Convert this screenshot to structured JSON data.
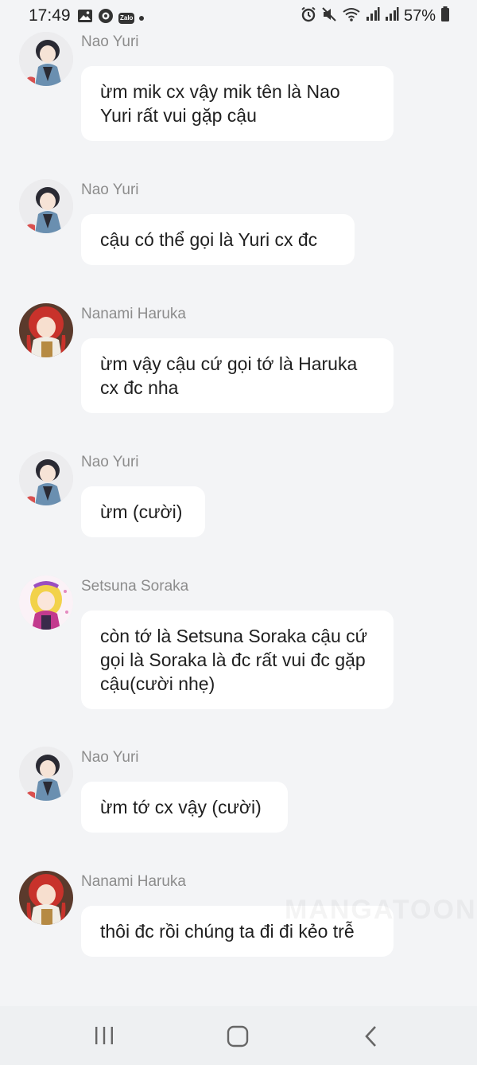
{
  "status_bar": {
    "time": "17:49",
    "battery": "57%",
    "zalo_badge": "Zalo",
    "icons": [
      "image-icon",
      "messenger-icon",
      "zalo-icon",
      "dot-icon",
      "alarm-icon",
      "mute-icon",
      "wifi-icon",
      "signal-icon",
      "signal-icon",
      "battery-icon"
    ]
  },
  "messages": [
    {
      "sender": "Nao Yuri",
      "avatar": "nao-yuri",
      "text": "ừm mik cx vậy mik tên là Nao Yuri rất vui gặp cậu"
    },
    {
      "sender": "Nao Yuri",
      "avatar": "nao-yuri",
      "text": "cậu có thể gọi là Yuri cx đc"
    },
    {
      "sender": "Nanami Haruka",
      "avatar": "nanami-haruka",
      "text": "ừm vậy cậu cứ gọi tớ là Haruka cx đc nha"
    },
    {
      "sender": "Nao Yuri",
      "avatar": "nao-yuri",
      "text": "ừm (cười)"
    },
    {
      "sender": "Setsuna Soraka",
      "avatar": "setsuna-soraka",
      "text": "còn tớ là Setsuna Soraka cậu cứ gọi là Soraka là đc rất vui đc gặp cậu(cười nhẹ)"
    },
    {
      "sender": "Nao Yuri",
      "avatar": "nao-yuri",
      "text": "ừm tớ cx vậy (cười)"
    },
    {
      "sender": "Nanami Haruka",
      "avatar": "nanami-haruka",
      "text": "thôi đc rồi chúng ta đi đi kẻo trễ"
    }
  ],
  "watermark": "MANGATOON",
  "nav": {
    "icons": [
      "recent-apps-icon",
      "home-icon",
      "back-icon"
    ]
  },
  "colors": {
    "background": "#f3f4f6",
    "bubble": "#ffffff",
    "sender_name": "#8c8c8c"
  }
}
